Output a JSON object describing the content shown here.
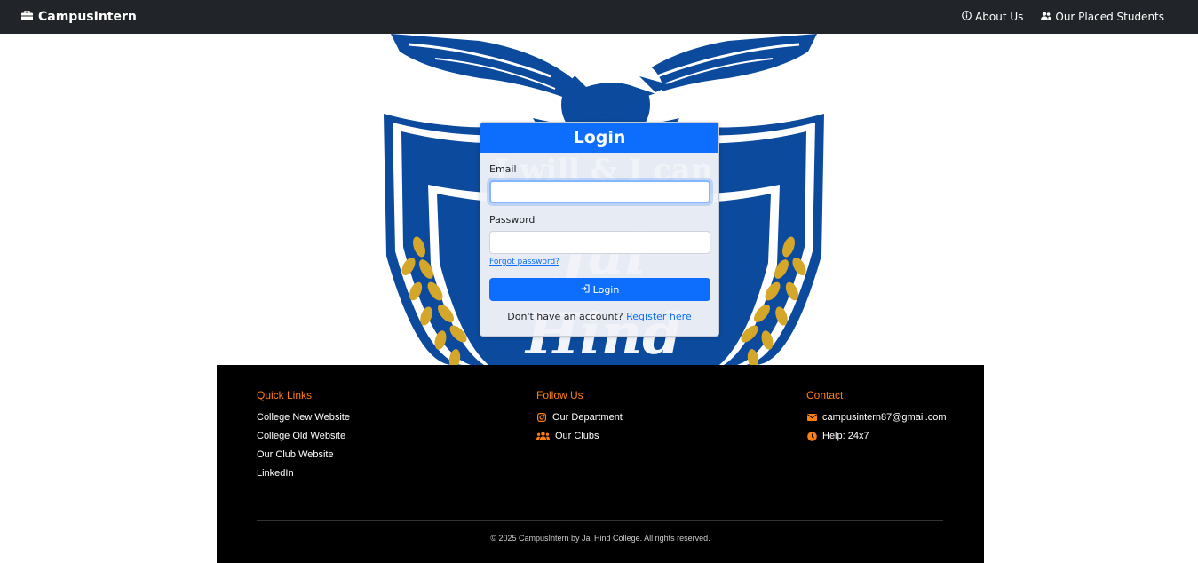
{
  "navbar": {
    "brand": "CampusIntern",
    "about": "About Us",
    "placed": "Our Placed Students"
  },
  "login": {
    "title": "Login",
    "email_label": "Email",
    "email_value": "",
    "password_label": "Password",
    "password_value": "",
    "forgot": "Forgot password?",
    "button": "Login",
    "no_account": "Don't have an account?",
    "register": "Register here"
  },
  "crest": {
    "motto": "I will & I can",
    "college_name": "Jai Hind"
  },
  "footer": {
    "quick_links": {
      "heading": "Quick Links",
      "items": [
        "College New Website",
        "College Old Website",
        "Our Club Website",
        "LinkedIn"
      ]
    },
    "follow": {
      "heading": "Follow Us",
      "items": [
        "Our Department",
        "Our Clubs"
      ]
    },
    "contact": {
      "heading": "Contact",
      "email": "campusintern87@gmail.com",
      "help": "Help: 24x7"
    },
    "copyright": "© 2025 CampusIntern by Jai Hind College. All rights reserved."
  },
  "colors": {
    "navbar": "#212529",
    "primary": "#0d6efd",
    "footer_bg": "#000000",
    "footer_heading": "#fd7e14",
    "crest_blue": "#0b4a9c",
    "crest_gold": "#d4a62a"
  },
  "icons": {
    "brand": "briefcase-icon",
    "about": "info-circle-icon",
    "placed": "people-icon",
    "login_button": "sign-in-icon",
    "department": "instagram-icon",
    "clubs": "users-icon",
    "email": "envelope-icon",
    "help": "clock-icon"
  }
}
